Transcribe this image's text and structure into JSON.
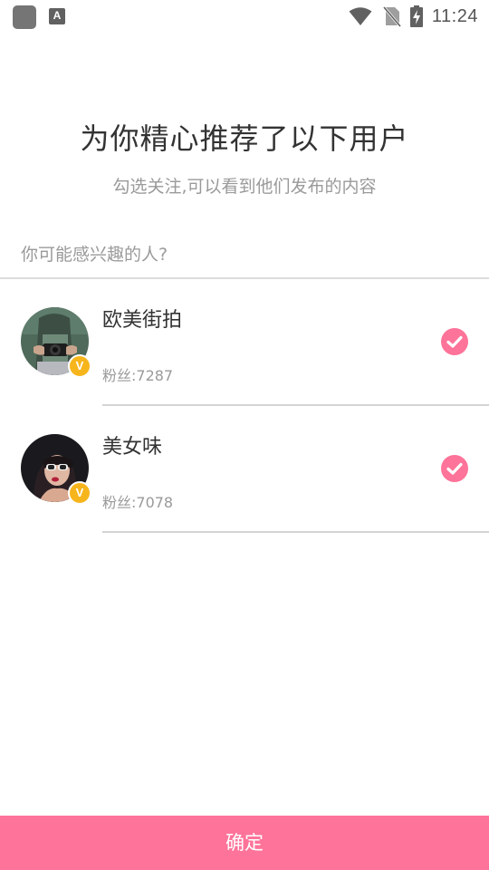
{
  "status_bar": {
    "time": "11:24",
    "notification_icon_letter": "A"
  },
  "header": {
    "title": "为你精心推荐了以下用户",
    "subtitle": "勾选关注,可以看到他们发布的内容"
  },
  "section": {
    "label": "你可能感兴趣的人?"
  },
  "users": [
    {
      "name": "欧美街拍",
      "fans": "粉丝:7287",
      "verified_badge": "V",
      "checked": true
    },
    {
      "name": "美女味",
      "fans": "粉丝:7078",
      "verified_badge": "V",
      "checked": true
    }
  ],
  "footer": {
    "confirm_label": "确定"
  },
  "colors": {
    "accent": "#fe7399",
    "badge": "#f7b51c",
    "title_text": "#333333",
    "muted_text": "#9a9a9a"
  }
}
